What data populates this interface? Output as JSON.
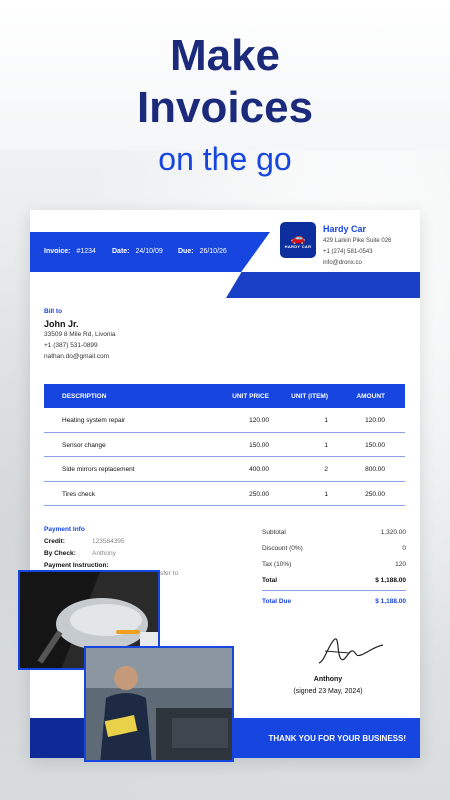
{
  "headline": {
    "line1": "Make",
    "line2": "Invoices",
    "sub": "on the go"
  },
  "invoice": {
    "labels": {
      "invoice": "Invoice:",
      "date": "Date:",
      "due": "Due:"
    },
    "values": {
      "invoice": "#1234",
      "date": "24/10/09",
      "due": "26/10/26"
    },
    "company": {
      "logo_text": "HARDY CAR",
      "name": "Hardy Car",
      "address": "429 Larkin Pike Suite 026",
      "phone": "+1 (274) 581-0543",
      "email": "info@dronx.co"
    },
    "bill_to": {
      "title": "Bill to",
      "name": "John Jr.",
      "address": "33509 8 Mile Rd, Livonia",
      "phone": "+1 (387) 531-0899",
      "email": "nathan.do@gmail.com"
    },
    "table": {
      "headers": {
        "desc": "DESCRIPTION",
        "price": "UNIT PRICE",
        "unit": "UNIT (ITEM)",
        "amount": "AMOUNT"
      },
      "rows": [
        {
          "desc": "Heating system repair",
          "price": "120.00",
          "unit": "1",
          "amount": "120.00"
        },
        {
          "desc": "Sensor change",
          "price": "150.00",
          "unit": "1",
          "amount": "150.00"
        },
        {
          "desc": "Side mirrors replacement",
          "price": "400.00",
          "unit": "2",
          "amount": "800.00"
        },
        {
          "desc": "Tires check",
          "price": "250.00",
          "unit": "1",
          "amount": "250.00"
        }
      ]
    },
    "payment": {
      "title": "Payment Info",
      "credit_label": "Credit:",
      "credit_value": "123584395",
      "check_label": "By Check:",
      "check_value": "Anthony",
      "instruction_label": "Payment Instruction:",
      "instruction_value": "sfer to"
    },
    "summary": {
      "subtotal_label": "Subtotal",
      "subtotal": "1,320.00",
      "discount_label": "Discount (0%)",
      "discount": "0",
      "tax_label": "Tax (10%)",
      "tax": "120",
      "total_label": "Total",
      "total": "$ 1,188.00",
      "due_label": "Total Due",
      "due": "$ 1,188.00"
    },
    "signature": {
      "name": "Anthony",
      "date": "(signed 23 May, 2024)"
    },
    "footer": "THANK YOU FOR YOUR BUSINESS!"
  },
  "colors": {
    "accent": "#1745e0",
    "title": "#1b2a7a",
    "dark_accent": "#0e2a99"
  }
}
